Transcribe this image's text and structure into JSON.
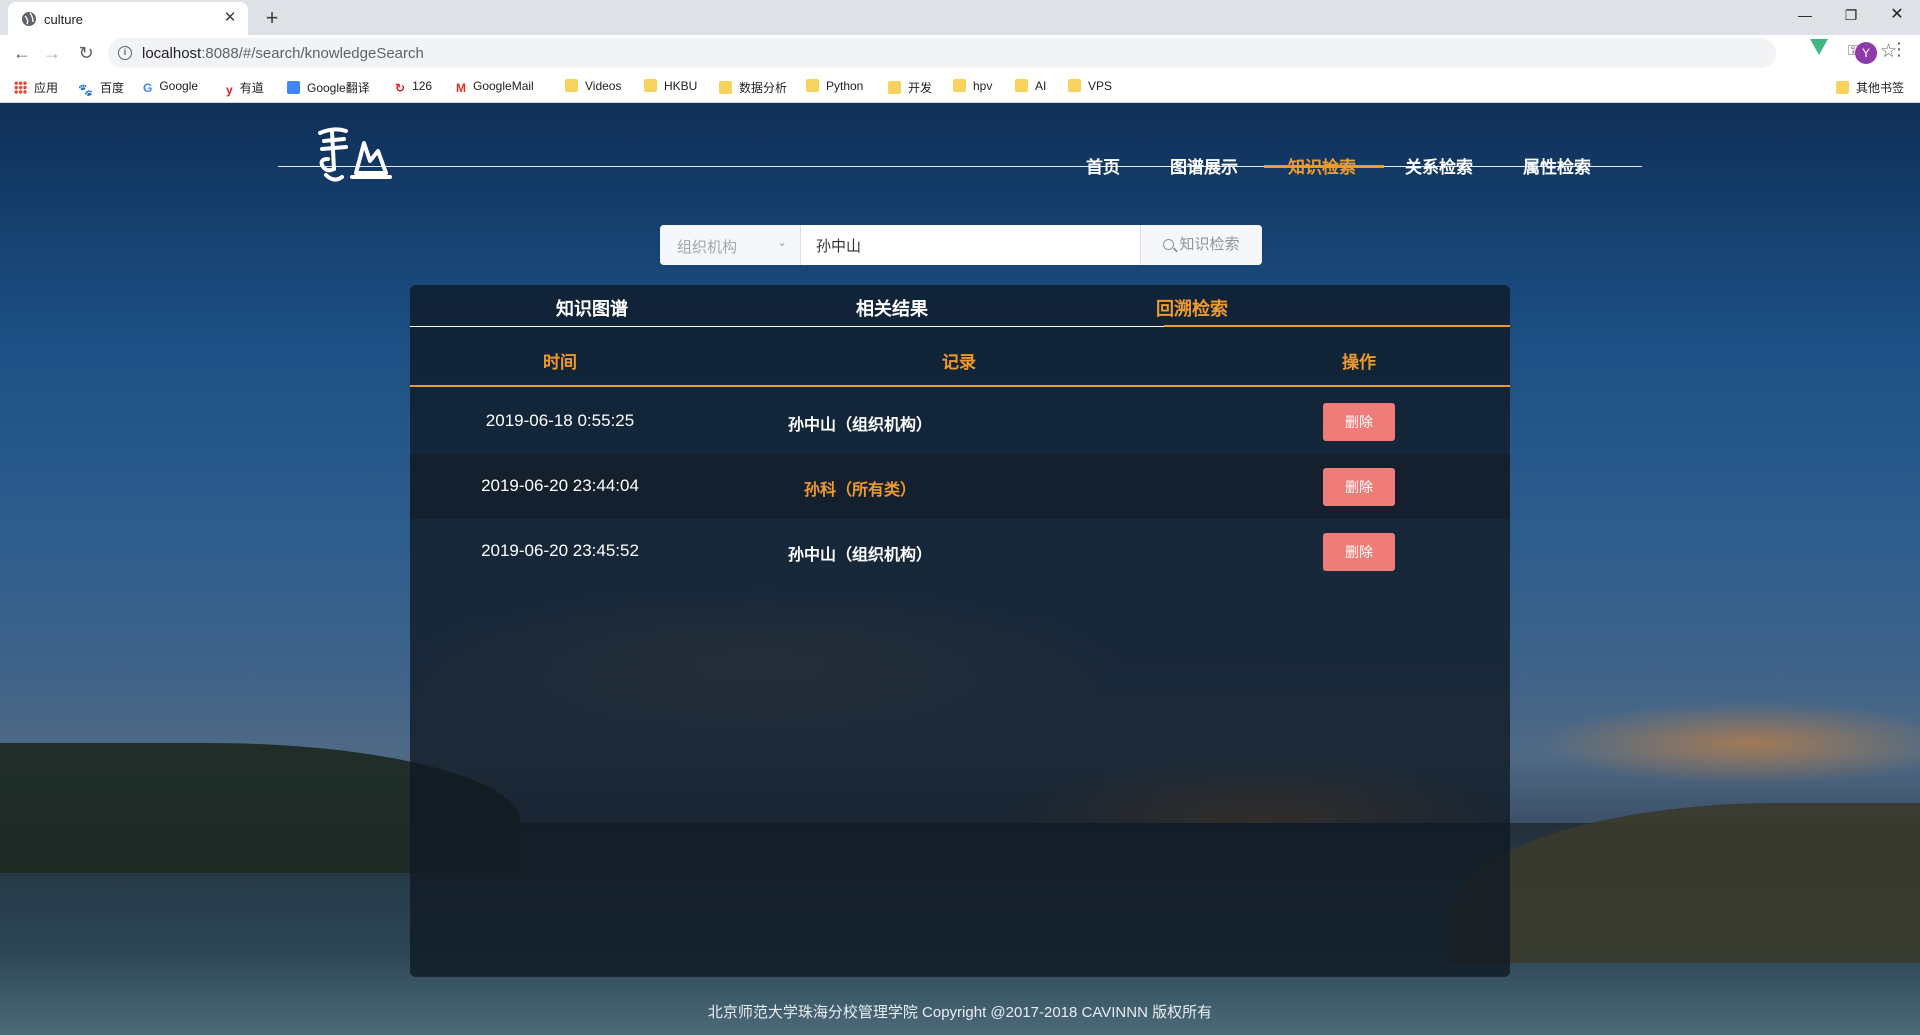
{
  "browser": {
    "tab_title": "culture",
    "url_host": "localhost",
    "url_path": ":8088/#/search/knowledgeSearch",
    "avatar_letter": "Y",
    "bookmarks": [
      "应用",
      "百度",
      "Google",
      "有道",
      "Google翻译",
      "126",
      "GoogleMail",
      "Videos",
      "HKBU",
      "数据分析",
      "Python",
      "开发",
      "hpv",
      "AI",
      "VPS",
      "其他书签"
    ]
  },
  "nav": {
    "items": [
      "首页",
      "图谱展示",
      "知识检索",
      "关系检索",
      "属性检索"
    ],
    "active_index": 2
  },
  "search": {
    "category_placeholder": "组织机构",
    "query_value": "孙中山",
    "button_label": "知识检索"
  },
  "panel": {
    "tabs": [
      "知识图谱",
      "相关结果",
      "回溯检索"
    ],
    "active_tab": 2,
    "columns": [
      "时间",
      "记录",
      "操作"
    ],
    "rows": [
      {
        "time": "2019-06-18 0:55:25",
        "record": "孙中山（组织机构）",
        "action": "删除"
      },
      {
        "time": "2019-06-20 23:44:04",
        "record": "孙科（所有类）",
        "action": "删除"
      },
      {
        "time": "2019-06-20 23:45:52",
        "record": "孙中山（组织机构）",
        "action": "删除"
      }
    ]
  },
  "footer": {
    "text": "北京师范大学珠海分校管理学院 Copyright @2017-2018 CAVINNN 版权所有"
  },
  "colors": {
    "accent": "#ef9a2c",
    "delete_button": "#f07c7a"
  }
}
